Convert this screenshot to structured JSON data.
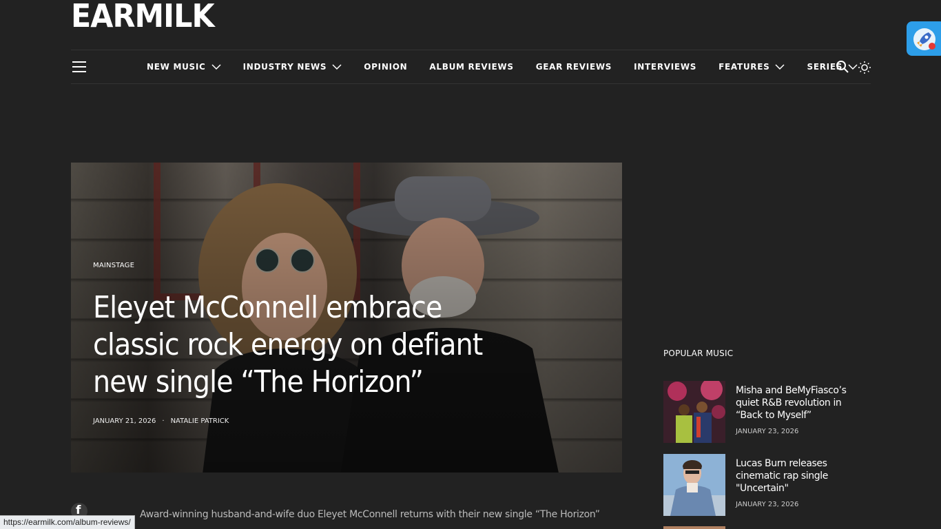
{
  "site": {
    "logo_text": "EARMILK"
  },
  "nav": {
    "items": [
      {
        "label": "NEW MUSIC",
        "has_dropdown": true
      },
      {
        "label": "INDUSTRY NEWS",
        "has_dropdown": true
      },
      {
        "label": "OPINION",
        "has_dropdown": false
      },
      {
        "label": "ALBUM REVIEWS",
        "has_dropdown": false
      },
      {
        "label": "GEAR REVIEWS",
        "has_dropdown": false
      },
      {
        "label": "INTERVIEWS",
        "has_dropdown": false
      },
      {
        "label": "FEATURES",
        "has_dropdown": true
      },
      {
        "label": "SERIES",
        "has_dropdown": true
      }
    ]
  },
  "hero": {
    "category": "MAINSTAGE",
    "title": "Eleyet McConnell embrace classic rock energy on defiant new single “The Horizon”",
    "date": "JANUARY 21, 2026",
    "separator": "·",
    "author": "NATALIE PATRICK"
  },
  "sidebar": {
    "heading": "POPULAR MUSIC",
    "items": [
      {
        "title": "Misha and BeMyFiasco’s quiet R&B revolution in “Back to Myself”",
        "date": "JANUARY 23, 2026"
      },
      {
        "title": "Lucas Burn releases cinematic rap single \"Uncertain\"",
        "date": "JANUARY 23, 2026"
      }
    ]
  },
  "article": {
    "intro": "Award-winning husband-and-wife duo Eleyet McConnell returns  with their new single “The Horizon”"
  },
  "status_bar": {
    "url": "https://earmilk.com/album-reviews/"
  },
  "colors": {
    "background": "#222222",
    "extension_accent": "#2d9ee9"
  }
}
